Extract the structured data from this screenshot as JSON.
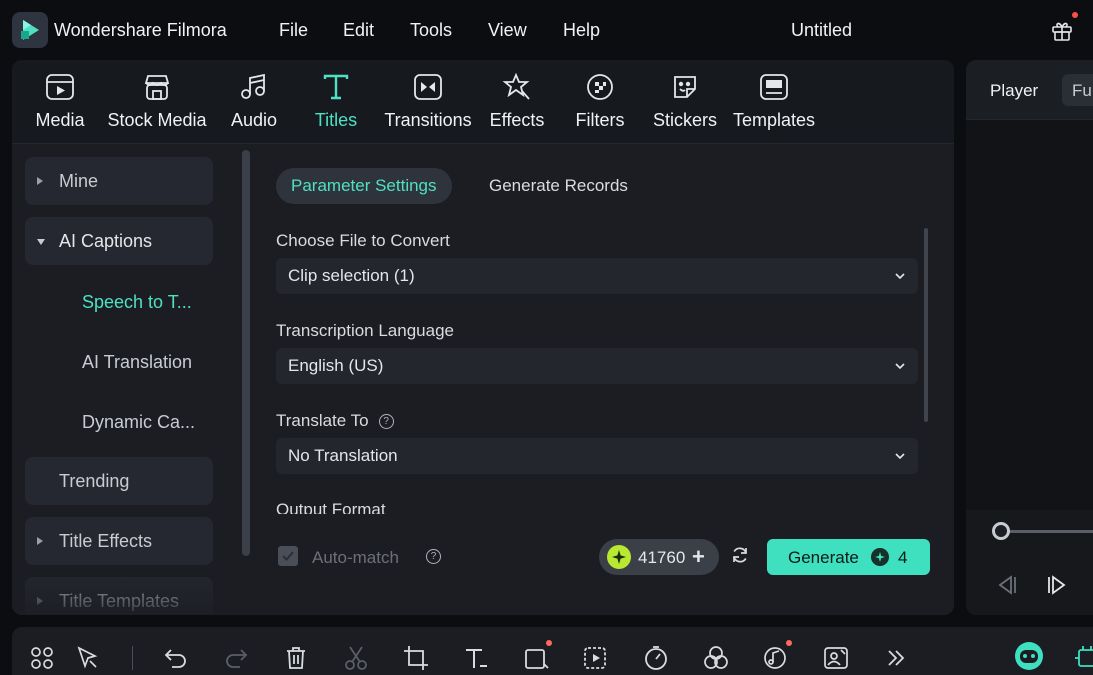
{
  "app": {
    "name": "Wondershare Filmora",
    "document_title": "Untitled",
    "menu": [
      "File",
      "Edit",
      "Tools",
      "View",
      "Help"
    ],
    "accent_color": "#4fe0c4"
  },
  "tabs": [
    {
      "label": "Media",
      "icon": "media-icon"
    },
    {
      "label": "Stock Media",
      "icon": "stock-media-icon"
    },
    {
      "label": "Audio",
      "icon": "audio-icon"
    },
    {
      "label": "Titles",
      "icon": "titles-icon",
      "active": true
    },
    {
      "label": "Transitions",
      "icon": "transitions-icon"
    },
    {
      "label": "Effects",
      "icon": "effects-icon"
    },
    {
      "label": "Filters",
      "icon": "filters-icon"
    },
    {
      "label": "Stickers",
      "icon": "stickers-icon"
    },
    {
      "label": "Templates",
      "icon": "templates-icon"
    }
  ],
  "sidebar": {
    "items": [
      {
        "label": "Mine",
        "expandable": true
      },
      {
        "label": "AI Captions",
        "expanded": true
      },
      {
        "label": "Trending"
      },
      {
        "label": "Title Effects",
        "expandable": true
      },
      {
        "label": "Title Templates",
        "expandable": true
      }
    ],
    "subitems": [
      {
        "label": "Speech to T...",
        "active": true
      },
      {
        "label": "AI Translation"
      },
      {
        "label": "Dynamic Ca..."
      }
    ]
  },
  "content": {
    "subtabs": {
      "parameter": "Parameter Settings",
      "records": "Generate Records"
    },
    "fields": [
      {
        "label": "Choose File to Convert",
        "value": "Clip selection (1)"
      },
      {
        "label": "Transcription Language",
        "value": "English (US)"
      },
      {
        "label": "Translate To",
        "value": "No Translation",
        "help": "?"
      }
    ],
    "output_format_label": "Output Format",
    "auto_match_label": "Auto-match",
    "help_glyph": "?",
    "credits": "41760",
    "credits_plus": "+",
    "generate_label": "Generate",
    "generate_cost": "4"
  },
  "player": {
    "tabs": [
      "Player",
      "Fu"
    ]
  },
  "toolbar": {
    "icons": [
      "layout-icon",
      "select-tool-icon",
      "undo-icon",
      "redo-icon",
      "delete-icon",
      "split-icon",
      "crop-icon",
      "text-icon",
      "shape-icon",
      "auto-reframe-icon",
      "speed-icon",
      "color-match-icon",
      "ai-audio-icon",
      "ai-portrait-icon",
      "more-icon",
      "ai-mate-icon",
      "ai-tools-icon"
    ]
  }
}
